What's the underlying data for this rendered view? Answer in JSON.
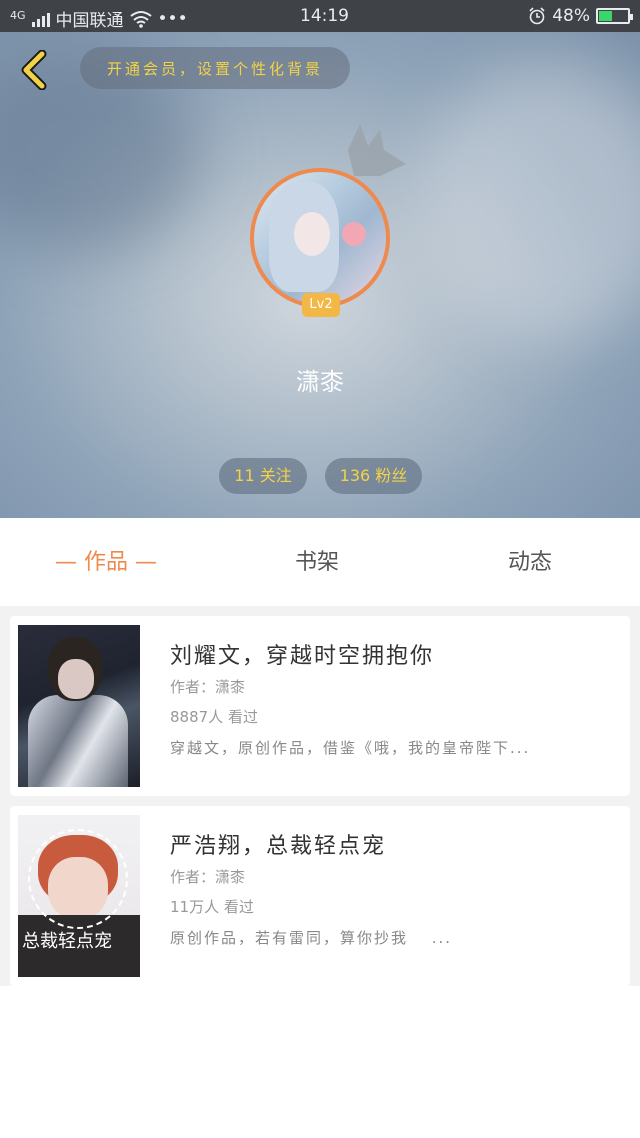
{
  "status_bar": {
    "network": "4G",
    "carrier": "中国联通",
    "dots": "•••",
    "time": "14:19",
    "battery": "48%",
    "battery_level": 0.48
  },
  "header": {
    "vip_banner": "开通会员，设置个性化背景",
    "level": "Lv2",
    "username": "潇桼",
    "following": "11 关注",
    "fans": "136 粉丝"
  },
  "tabs": [
    {
      "label": "— 作品 —",
      "active": true
    },
    {
      "label": "书架",
      "active": false
    },
    {
      "label": "动态",
      "active": false
    }
  ],
  "books": [
    {
      "title": "刘耀文，穿越时空拥抱你",
      "author": "作者：潇桼",
      "views": "8887人 看过",
      "description": "穿越文，原创作品，借鉴《哦，我的皇帝陛下..."
    },
    {
      "title": "严浩翔，总裁轻点宠",
      "author": "作者：潇桼",
      "views": "11万人 看过",
      "description": "原创作品，若有雷同，算你抄我　 ...",
      "cover_text": "总裁轻点宠"
    }
  ],
  "colors": {
    "accent": "#ef8a4e",
    "gold_text": "#f2d347",
    "level_badge": "#f2b744",
    "battery_fill": "#38d66b"
  }
}
